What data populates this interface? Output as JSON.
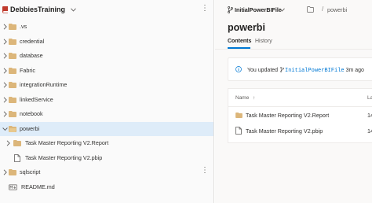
{
  "repo": {
    "name": "DebbiesTraining"
  },
  "tree": [
    {
      "label": ".vs",
      "type": "folder"
    },
    {
      "label": "credential",
      "type": "folder"
    },
    {
      "label": "database",
      "type": "folder"
    },
    {
      "label": "Fabric",
      "type": "folder"
    },
    {
      "label": "integrationRuntime",
      "type": "folder"
    },
    {
      "label": "linkedService",
      "type": "folder"
    },
    {
      "label": "notebook",
      "type": "folder"
    },
    {
      "label": "powerbi",
      "type": "folder",
      "expanded": true,
      "selected": true
    },
    {
      "label": "Task Master Reporting V2.Report",
      "type": "folder"
    },
    {
      "label": "Task Master Reporting V2.pbip",
      "type": "file"
    },
    {
      "label": "sqlscript",
      "type": "folder"
    },
    {
      "label": "README.md",
      "type": "markdown"
    }
  ],
  "branch": {
    "name": "InitialPowerBIFile"
  },
  "path": {
    "separator": "/",
    "current": "powerbi"
  },
  "page": {
    "title": "powerbi"
  },
  "tabs": [
    {
      "label": "Contents",
      "active": true
    },
    {
      "label": "History",
      "active": false
    }
  ],
  "banner": {
    "prefix": "You updated",
    "branch": "InitialPowerBIFile",
    "time": "3m ago"
  },
  "table": {
    "headers": {
      "name": "Name",
      "sort_arrow": "↑",
      "last": "La"
    },
    "rows": [
      {
        "name": "Task Master Reporting V2.Report",
        "type": "folder",
        "value": "14"
      },
      {
        "name": "Task Master Reporting V2.pbip",
        "type": "file",
        "value": "14"
      }
    ]
  },
  "colors": {
    "accent": "#0078d4",
    "folder": "#dcb67a",
    "selected_row": "#deecf9"
  }
}
